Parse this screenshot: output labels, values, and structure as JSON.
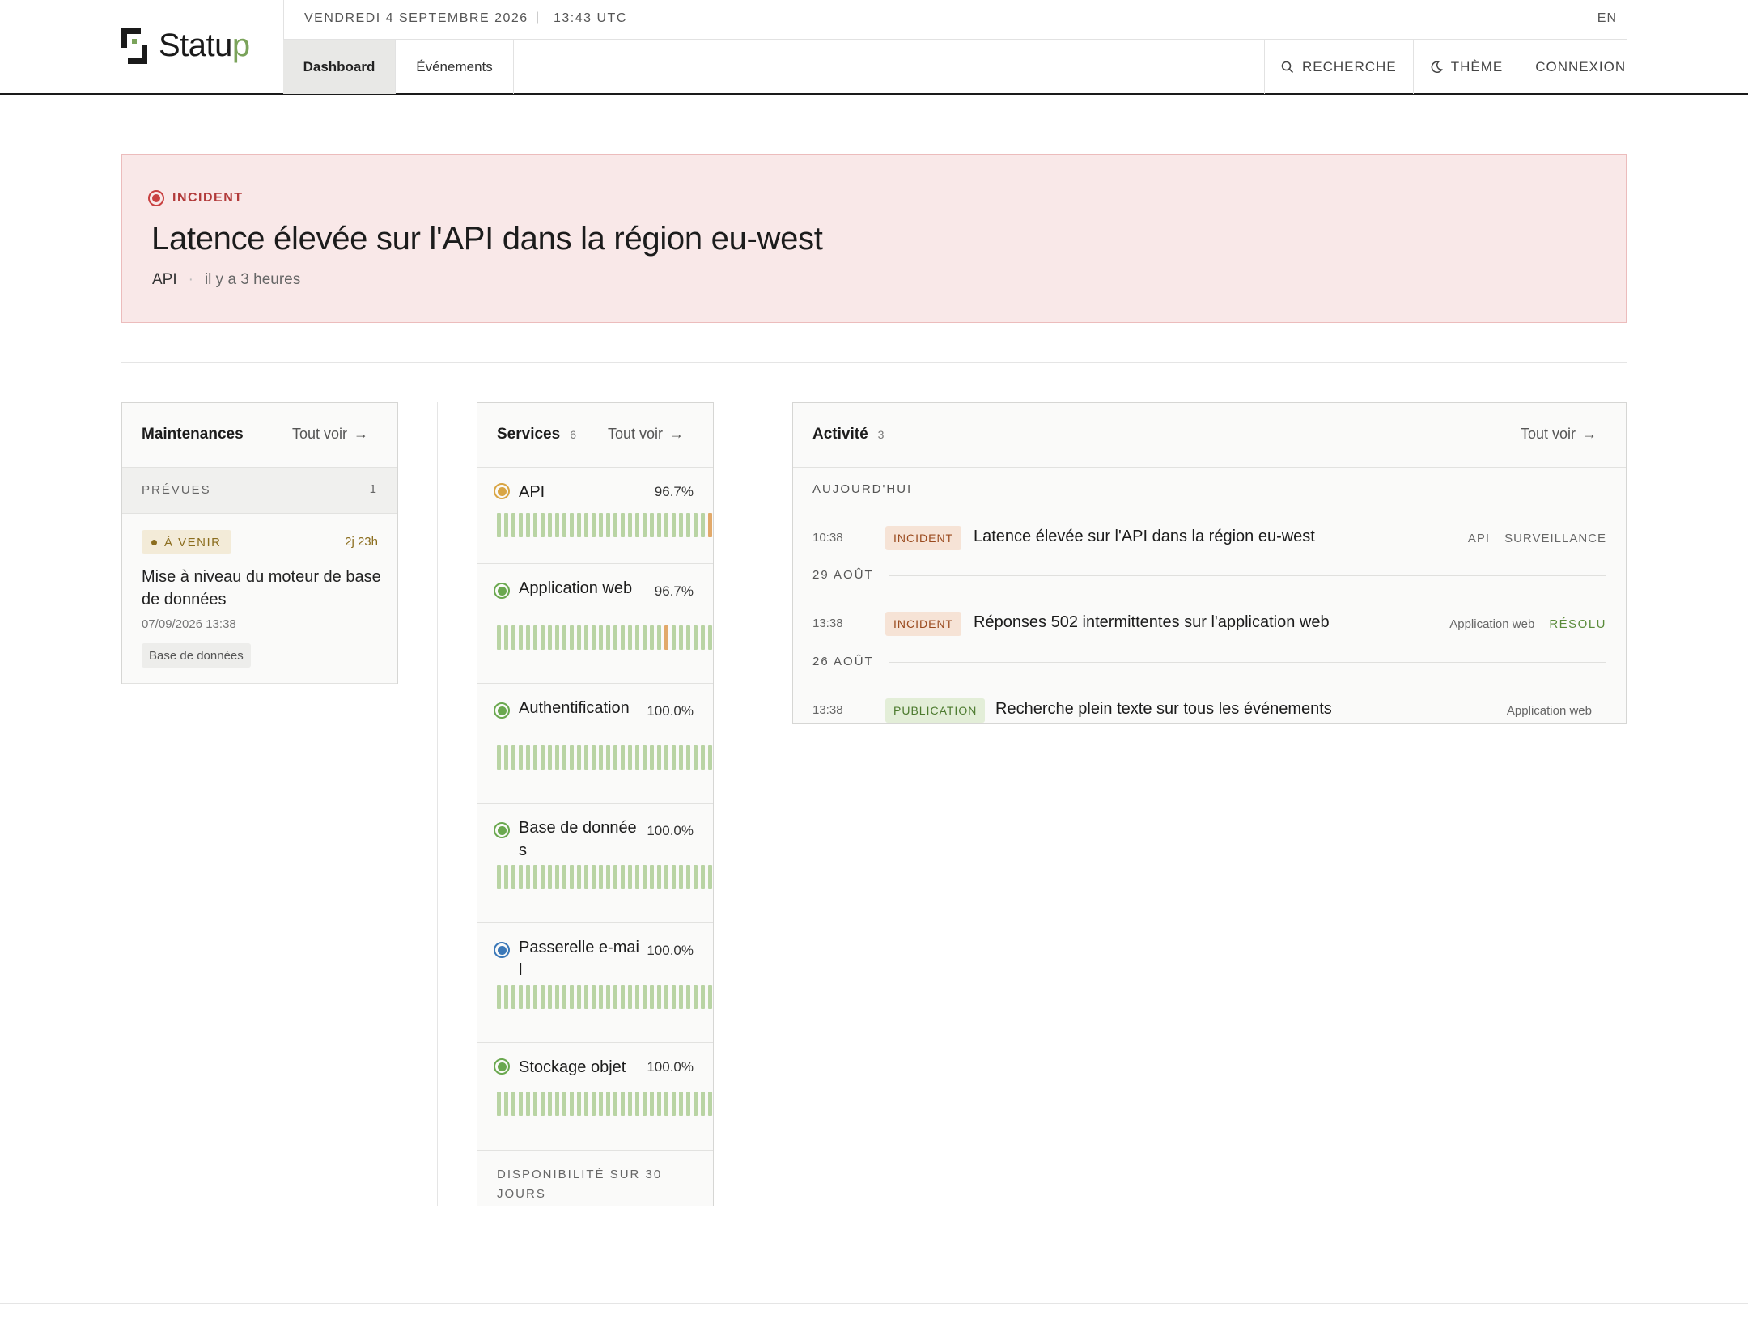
{
  "brand": {
    "name_main": "Statu",
    "name_accent": "p"
  },
  "topbar": {
    "date": "VENDREDI 4 SEPTEMBRE 2026",
    "separator": "|",
    "time": "13:43 UTC",
    "lang": "EN"
  },
  "nav": {
    "tabs": [
      {
        "label": "Dashboard",
        "active": true
      },
      {
        "label": "Événements",
        "active": false
      }
    ],
    "search_label": "RECHERCHE",
    "theme_label": "THÈME",
    "login_label": "CONNEXION"
  },
  "banner": {
    "badge": "INCIDENT",
    "title": "Latence élevée sur l'API dans la région eu-west",
    "service": "API",
    "dot": "·",
    "when": "il y a 3 heures",
    "color": "#c94040"
  },
  "maintenances": {
    "title": "Maintenances",
    "link": "Tout voir",
    "section_label": "PRÉVUES",
    "section_count": "1",
    "item": {
      "badge": "À VENIR",
      "eta": "2j 23h",
      "title": "Mise à niveau du moteur de base de données",
      "date": "07/09/2026 13:38",
      "tag": "Base de données"
    }
  },
  "services": {
    "title": "Services",
    "count": "6",
    "link": "Tout voir",
    "footer": "DISPONIBILITÉ SUR 30 JOURS",
    "items": [
      {
        "name": "API",
        "uptime": "96.7%",
        "status_color": "#d9a544",
        "degraded_days": [
          29
        ]
      },
      {
        "name": "Application web",
        "uptime": "96.7%",
        "status_color": "#6aa84f",
        "degraded_days": [
          23
        ]
      },
      {
        "name": "Authentification",
        "uptime": "100.0%",
        "status_color": "#6aa84f",
        "degraded_days": []
      },
      {
        "name": "Base de données",
        "uptime": "100.0%",
        "status_color": "#6aa84f",
        "degraded_days": []
      },
      {
        "name": "Passerelle e-mail",
        "uptime": "100.0%",
        "status_color": "#3b78b8",
        "degraded_days": []
      },
      {
        "name": "Stockage objet",
        "uptime": "100.0%",
        "status_color": "#6aa84f",
        "degraded_days": []
      }
    ]
  },
  "activity": {
    "title": "Activité",
    "count": "3",
    "link": "Tout voir",
    "days": [
      {
        "label": "AUJOURD'HUI",
        "entries": [
          {
            "time": "10:38",
            "type": "INCIDENT",
            "title": "Latence élevée sur l'API dans la région eu-west",
            "meta": [
              "API",
              "SURVEILLANCE"
            ]
          }
        ]
      },
      {
        "label": "29 AOÛT",
        "entries": [
          {
            "time": "13:38",
            "type": "INCIDENT",
            "title": "Réponses 502 intermittentes sur l'application web",
            "meta": [
              "Application web",
              "RÉSOLU"
            ]
          }
        ]
      },
      {
        "label": "26 AOÛT",
        "entries": [
          {
            "time": "13:38",
            "type": "PUBLICATION",
            "title": "Recherche plein texte sur tous les événements",
            "meta": [
              "Application web"
            ]
          }
        ]
      }
    ]
  },
  "colors": {
    "bar_ok": "#b9d4a4",
    "bar_degraded": "#e2a96a",
    "incident_bg": "#f6e3d6",
    "incident_fg": "#9a4a1e",
    "publication_bg": "#e3eed8",
    "publication_fg": "#4c7a2e"
  }
}
